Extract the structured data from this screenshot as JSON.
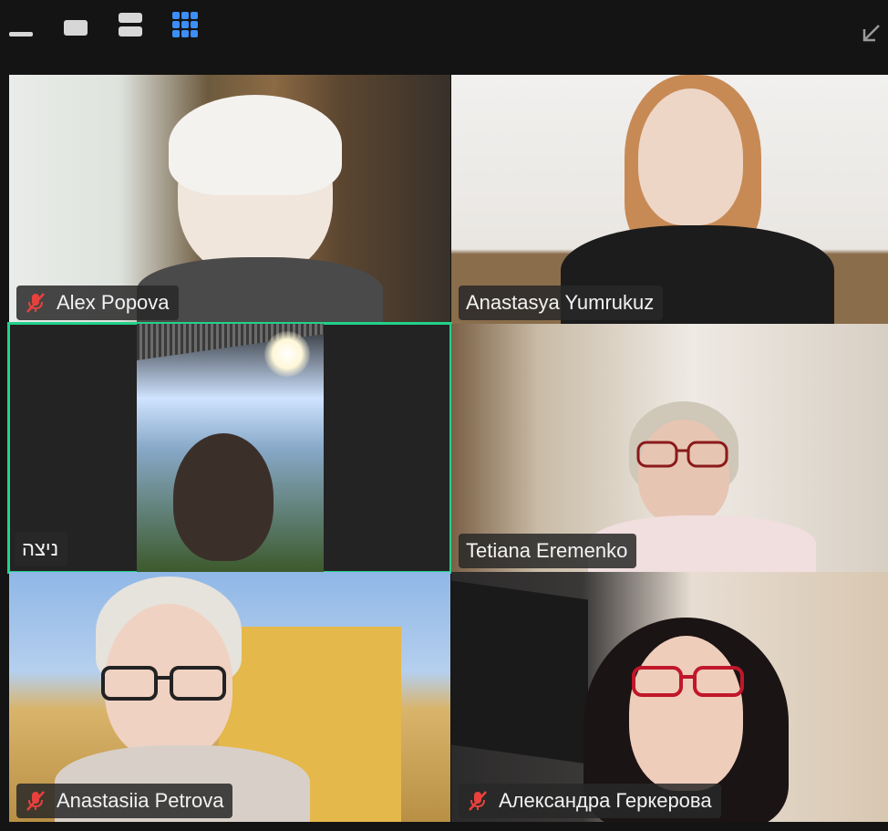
{
  "toolbar": {
    "minimize_icon": "minimize-icon",
    "speaker_view_icon": "speaker-view-icon",
    "stacked_view_icon": "stacked-view-icon",
    "gallery_view_icon": "gallery-view-icon",
    "exit_fullscreen_icon": "exit-fullscreen-icon",
    "active_view": "gallery",
    "accent_color": "#3b8ff7"
  },
  "participants": [
    {
      "name": "Alex Popova",
      "muted": true
    },
    {
      "name": "Anastasya Yumrukuz",
      "muted": false
    },
    {
      "name": "ניצה",
      "muted": false,
      "active_speaker": true
    },
    {
      "name": "Tetiana Eremenko",
      "muted": false
    },
    {
      "name": "Anastasiia Petrova",
      "muted": true
    },
    {
      "name": "Александра Геркерова",
      "muted": true
    }
  ],
  "colors": {
    "background": "#141414",
    "active_speaker_border": "#23d18b",
    "mute_icon": "#e8413d"
  }
}
